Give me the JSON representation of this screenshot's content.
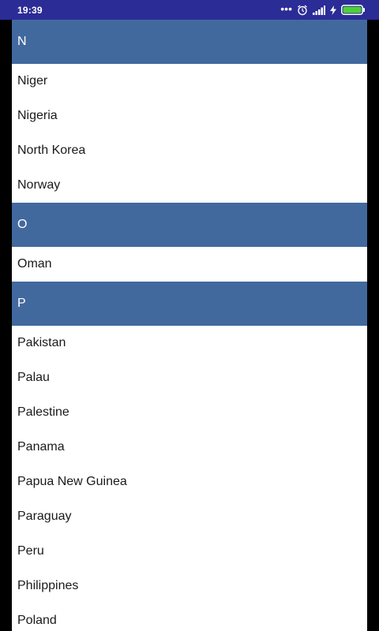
{
  "status_bar": {
    "time": "19:39",
    "icons": [
      "more-dots-icon",
      "alarm-icon",
      "signal-icon",
      "charging-icon",
      "battery-icon"
    ],
    "battery_level": 1.0
  },
  "colors": {
    "status_bar_bg": "#2b2c96",
    "section_header_bg": "#42699e",
    "list_bg": "#ffffff",
    "battery_green": "#4cd137"
  },
  "sections": [
    {
      "letter": "N",
      "items": [
        "Niger",
        "Nigeria",
        "North Korea",
        "Norway"
      ]
    },
    {
      "letter": "O",
      "items": [
        "Oman"
      ]
    },
    {
      "letter": "P",
      "items": [
        "Pakistan",
        "Palau",
        "Palestine",
        "Panama",
        "Papua New Guinea",
        "Paraguay",
        "Peru",
        "Philippines",
        "Poland"
      ]
    }
  ]
}
